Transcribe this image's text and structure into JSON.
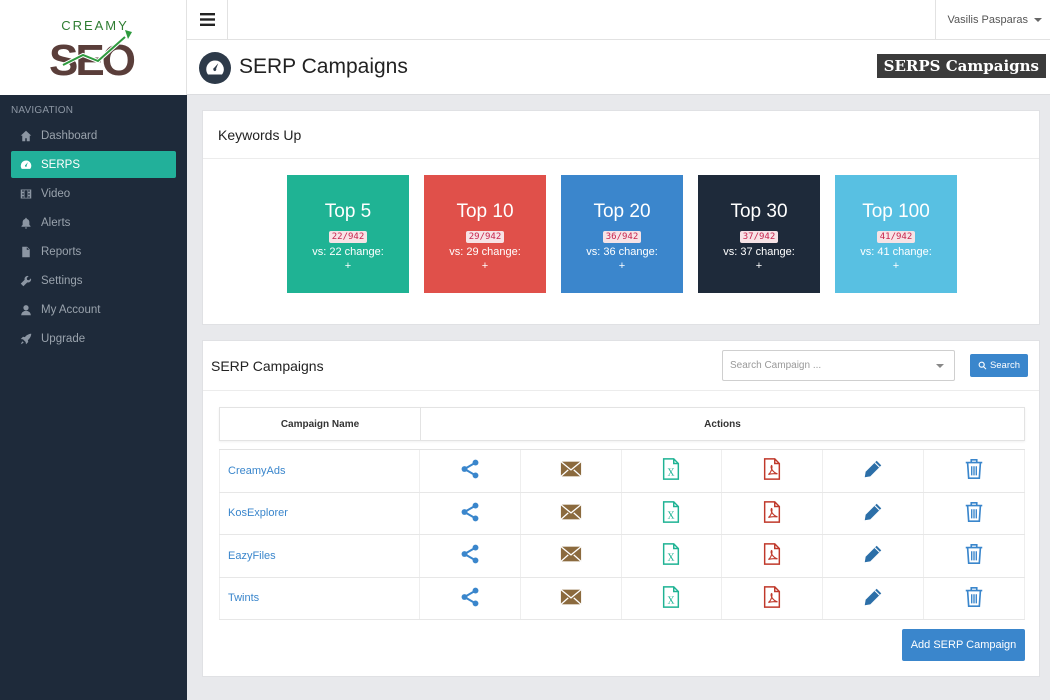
{
  "app": {
    "logo_word_top": "CREAMY",
    "logo_word_main": "SEO"
  },
  "sidebar": {
    "heading": "NAVIGATION",
    "items": [
      {
        "label": "Dashboard",
        "icon": "home-icon"
      },
      {
        "label": "SERPS",
        "icon": "dashboard-gauge-icon",
        "active": true
      },
      {
        "label": "Video",
        "icon": "film-icon"
      },
      {
        "label": "Alerts",
        "icon": "bell-icon"
      },
      {
        "label": "Reports",
        "icon": "file-icon"
      },
      {
        "label": "Settings",
        "icon": "wrench-icon"
      },
      {
        "label": "My Account",
        "icon": "user-icon"
      },
      {
        "label": "Upgrade",
        "icon": "rocket-icon"
      }
    ]
  },
  "topbar": {
    "user_name": "Vasilis Pasparas"
  },
  "page_header": {
    "title": "SERP Campaigns",
    "badge": "SERPS Campaigns"
  },
  "keywords_panel": {
    "title": "Keywords Up",
    "cards": [
      {
        "title": "Top 5",
        "count": "22/942",
        "change": "vs: 22 change:",
        "plus": "+",
        "color": "#1fb394"
      },
      {
        "title": "Top 10",
        "count": "29/942",
        "change": "vs: 29 change:",
        "plus": "+",
        "color": "#e0504a"
      },
      {
        "title": "Top 20",
        "count": "36/942",
        "change": "vs: 36 change:",
        "plus": "+",
        "color": "#3b86cc"
      },
      {
        "title": "Top 30",
        "count": "37/942",
        "change": "vs: 37 change:",
        "plus": "+",
        "color": "#1e2a3a"
      },
      {
        "title": "Top 100",
        "count": "41/942",
        "change": "vs: 41 change:",
        "plus": "+",
        "color": "#58c0e2"
      }
    ]
  },
  "campaigns_panel": {
    "title": "SERP Campaigns",
    "search_placeholder": "Search Campaign ...",
    "search_button": "Search",
    "columns": {
      "name": "Campaign Name",
      "actions": "Actions"
    },
    "rows": [
      {
        "name": "CreamyAds"
      },
      {
        "name": "KosExplorer"
      },
      {
        "name": "EazyFiles"
      },
      {
        "name": "Twints"
      }
    ],
    "action_icons": [
      {
        "icon": "share-icon",
        "color": "#3a86cc"
      },
      {
        "icon": "envelope-icon",
        "color": "#8b6a3e"
      },
      {
        "icon": "excel-file-icon",
        "color": "#1fb394"
      },
      {
        "icon": "pdf-file-icon",
        "color": "#c0392b"
      },
      {
        "icon": "pencil-icon",
        "color": "#2c6fa8"
      },
      {
        "icon": "trash-icon",
        "color": "#3a86cc"
      }
    ],
    "add_button": "Add SERP Campaign"
  }
}
